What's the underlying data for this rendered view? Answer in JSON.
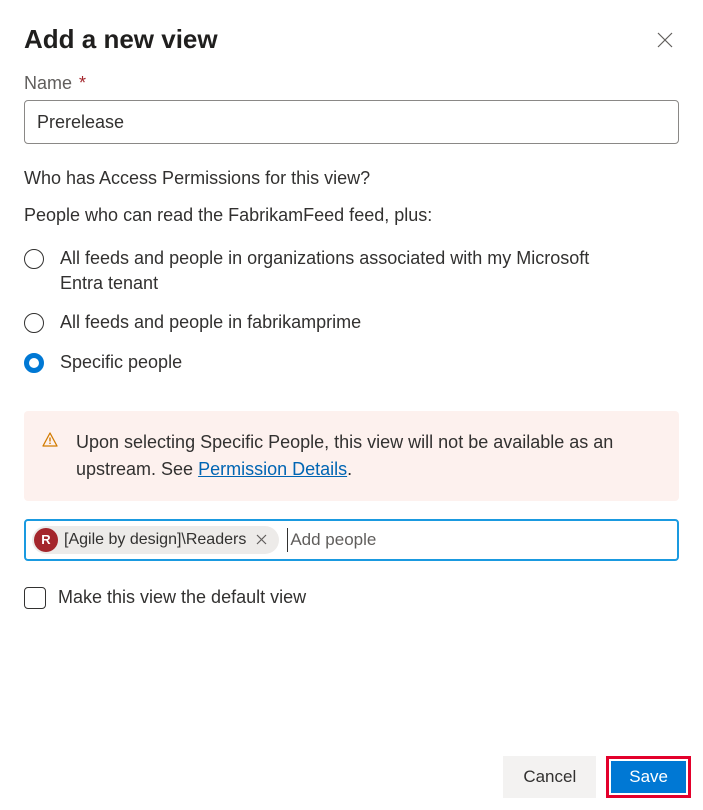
{
  "dialog": {
    "title": "Add a new view"
  },
  "name_field": {
    "label": "Name",
    "required_marker": "*",
    "value": "Prerelease"
  },
  "access": {
    "question": "Who has Access Permissions for this view?",
    "subline": "People who can read the FabrikamFeed feed, plus:",
    "options": [
      {
        "label": "All feeds and people in organizations associated with my Microsoft Entra tenant",
        "selected": false
      },
      {
        "label": "All feeds and people in fabrikamprime",
        "selected": false
      },
      {
        "label": "Specific people",
        "selected": true
      }
    ]
  },
  "notice": {
    "text_before_link": "Upon selecting Specific People, this view will not be available as an upstream. See ",
    "link_text": "Permission Details",
    "text_after_link": "."
  },
  "people_picker": {
    "chip": {
      "avatar_letter": "R",
      "label": "[Agile by design]\\Readers"
    },
    "placeholder": "Add people"
  },
  "default_checkbox": {
    "label": "Make this view the default view",
    "checked": false
  },
  "buttons": {
    "cancel": "Cancel",
    "save": "Save"
  }
}
